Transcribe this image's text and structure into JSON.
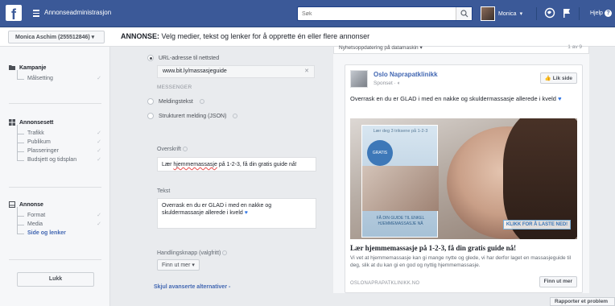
{
  "topbar": {
    "logo_letter": "f",
    "app_title": "Annonseadministrasjon",
    "search_placeholder": "Søk",
    "user_name": "Monica",
    "help_label": "Hjelp"
  },
  "account": {
    "selector_label": "Monica Aschim (255512846) ▾"
  },
  "header": {
    "title_bold": "ANNONSE:",
    "title_rest": " Velg medier, tekst og lenker for å opprette én eller flere annonser"
  },
  "sidebar": {
    "campaign": {
      "title": "Kampanje",
      "items": [
        "Målsetting"
      ]
    },
    "adset": {
      "title": "Annonsesett",
      "items": [
        "Trafikk",
        "Publikum",
        "Plasseringer",
        "Budsjett og tidsplan"
      ]
    },
    "ad": {
      "title": "Annonse",
      "items": [
        "Format",
        "Media",
        "Side og lenker"
      ],
      "active_index": 2
    },
    "close_label": "Lukk"
  },
  "form": {
    "url_option_label": "URL-adresse til nettsted",
    "url_value": "www.bit.ly/massasjeguide",
    "messenger_label": "MESSENGER",
    "message_text_label": "Meldingstekst",
    "structured_message_label": "Strukturert melding (JSON)",
    "headline_label": "Overskrift",
    "headline_prefix": "Lær ",
    "headline_underlined": "hjemmemassasje",
    "headline_suffix": " på 1-2-3, få din gratis guide nå!",
    "text_label": "Tekst",
    "text_value": "Overrask en du er GLAD i med en nakke og skuldermassasje allerede i kveld",
    "cta_label": "Handlingsknapp (valgfritt)",
    "cta_value": "Finn ut mer ▾",
    "advanced_link": "Skjul avanserte alternativer -"
  },
  "preview": {
    "selector_label": "Nyhetsoppdatering på datamaskin ▾",
    "pager": "1 av 9",
    "page_name": "Oslo Naprapatklinikk",
    "sponsored": "Sponset · ◐",
    "like_label": "Lik side",
    "post_text": "Overrask en du er GLAD i med en nakke og skuldermassasje allerede i kveld",
    "image": {
      "inset_top": "Lær deg 3 triksene på 1-2-3",
      "inset_circle": "GRATIS GUIDE",
      "inset_bottom": "FÅ DIN GUIDE TIL ENKEL HJEMMEMASSASJE NÅ",
      "cta_badge": "KLIKK FOR Å LASTE NED!"
    },
    "headline": "Lær hjemmemassasje på 1-2-3, få din gratis guide nå!",
    "description": "Vi vet at hjemmemassasje kan gi mange nytte og glede, vi har derfor laget en massasjeguide til deg, slik at du kan gi en god og nyttig hjemmemassasje.",
    "domain": "OSLONAPRAPATKLINIKK.NO",
    "cta_button": "Finn ut mer"
  },
  "footer": {
    "report_label": "Rapporter et problem"
  },
  "colors": {
    "brand_blue": "#3b5998",
    "link_blue": "#4267b2",
    "heart": "#3578e5"
  }
}
